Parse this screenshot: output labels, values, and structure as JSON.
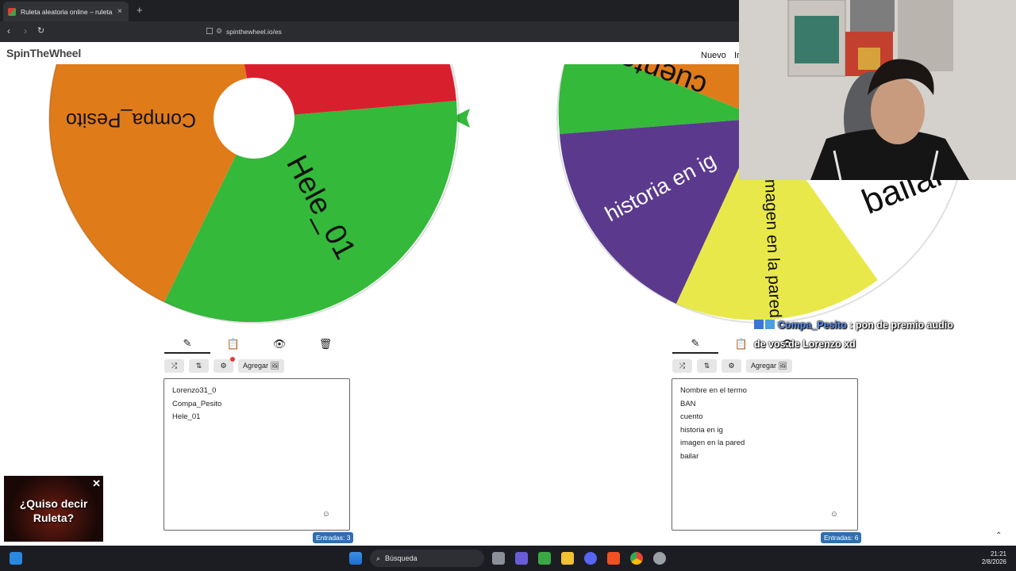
{
  "browser": {
    "tab_title": "Ruleta aleatoria online – ruleta d",
    "tab_close": "×",
    "new_tab": "+",
    "url": "spinthewheel.io/es"
  },
  "site": {
    "logo": "SpinTheWheel",
    "nuevo": "Nuevo",
    "nuevo_extra": "Ir"
  },
  "wheel_left": {
    "slices": [
      {
        "label": "Compa_Pesito",
        "color": "#e07b1a"
      },
      {
        "label": "Hele_01",
        "color": "#34b93a"
      },
      {
        "label": "Lorenzo31_0",
        "color": "#d81f2e"
      }
    ],
    "pointer_color": "#34b93a"
  },
  "wheel_right": {
    "slices": [
      {
        "label": "cuento",
        "color": "#34b93a"
      },
      {
        "label": "historia en ig",
        "color": "#5b3a8e"
      },
      {
        "label": "imagen en la pared",
        "color": "#e9e84b"
      },
      {
        "label": "bailar",
        "color": "#ffffff"
      }
    ]
  },
  "panel_left": {
    "tabs": [
      "✎",
      "📋",
      "👁",
      "🗑"
    ],
    "buttons": {
      "shuffle": "⤮",
      "sort": "⇅",
      "settings": "⚙",
      "add": "Agregar 🖼"
    },
    "entries": [
      "Lorenzo31_0",
      "Compa_Pesito",
      "Hele_01"
    ],
    "count_label": "Entradas: 3",
    "smiley": "☺"
  },
  "panel_right": {
    "tabs": [
      "✎",
      "📋",
      "👁"
    ],
    "buttons": {
      "shuffle": "⤮",
      "sort": "⇅",
      "settings": "⚙",
      "add": "Agregar 🖼"
    },
    "entries": [
      "Nombre en el termo",
      "BAN",
      "cuento",
      "historia en ig",
      "imagen en la pared",
      "bailar"
    ],
    "count_label": "Entradas: 6",
    "smiley": "☺"
  },
  "chat_overlay": {
    "user": "Compa_Pesito",
    "message_1": ": pon de premio audio",
    "message_2": "de vos de Lorenzo xd"
  },
  "ad": {
    "text_1": "¿Quiso decir",
    "text_2": "Ruleta?",
    "close": "✕"
  },
  "taskbar": {
    "search": "Búsqueda",
    "time": "21:21",
    "date": "2/8/2026"
  }
}
